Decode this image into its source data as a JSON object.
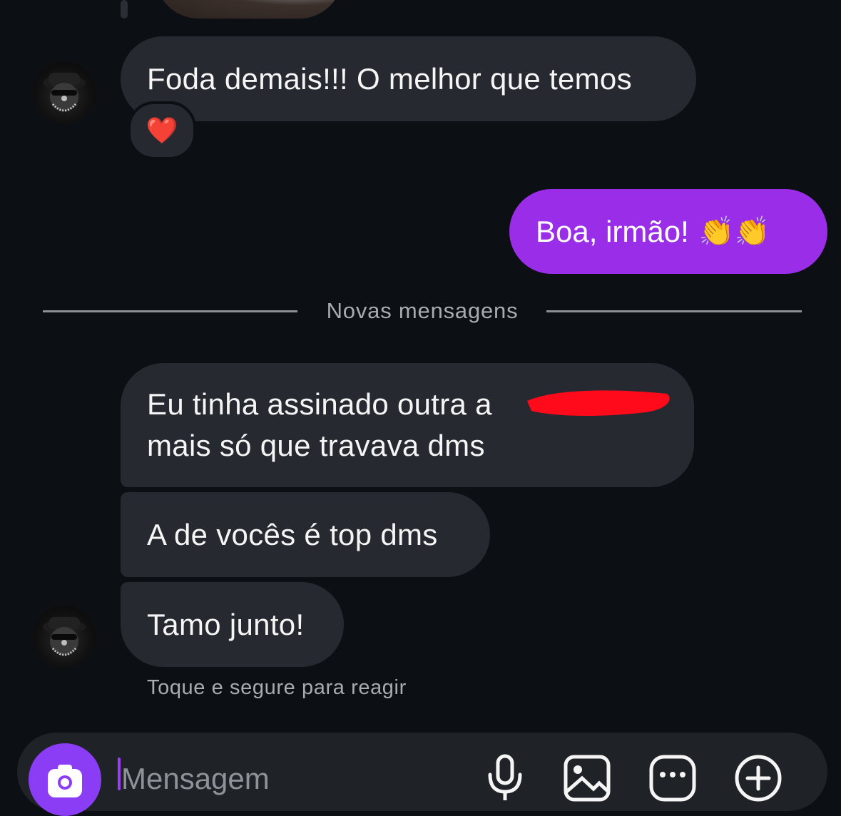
{
  "messages": {
    "m1_text": "Foda demais!!! O melhor que temos",
    "m1_reaction": "❤️",
    "m2_text": "Boa, irmão!",
    "m2_emoji": "👏👏",
    "divider": "Novas mensagens",
    "m3_line1": "Eu tinha assinado outra a",
    "m3_line2": "mais só que travava dms",
    "m4_text": "A de vocês é top dms",
    "m5_text": "Tamo junto!",
    "hint": "Toque e segure para reagir"
  },
  "composer": {
    "placeholder": "Mensagem"
  },
  "colors": {
    "background": "#0c1014",
    "incoming_bubble": "#262a30",
    "outgoing_bubble": "#9a2ee8",
    "camera_button": "#8b3cf5"
  },
  "icons": [
    "heart-icon",
    "camera-icon",
    "microphone-icon",
    "gallery-icon",
    "sticker-icon",
    "plus-icon"
  ]
}
